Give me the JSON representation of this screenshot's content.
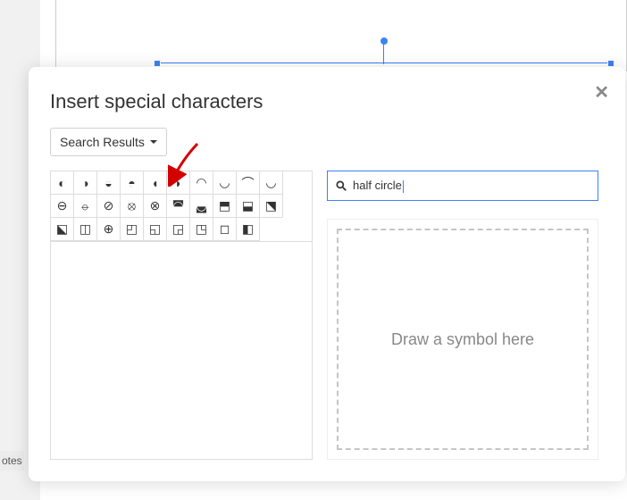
{
  "notes": {
    "label": "otes"
  },
  "dialog": {
    "title": "Insert special characters",
    "dropdown_label": "Search Results",
    "search": {
      "value": "half circle",
      "placeholder": ""
    },
    "draw_prompt": "Draw a symbol here",
    "grid": {
      "row1": [
        "◐",
        "◑",
        "◒",
        "◓",
        "◖",
        "◗",
        "◠",
        "◡",
        "⌒",
        "◡"
      ],
      "row2": [
        "⊖",
        "⦵",
        "⊘",
        "⦻",
        "⊗",
        "◚",
        "◛",
        "⬒",
        "⬓",
        "⬔"
      ],
      "row3": [
        "⬕",
        "◫",
        "⊕",
        "◰",
        "◱",
        "◲",
        "◳",
        "◻",
        "◧"
      ]
    }
  }
}
